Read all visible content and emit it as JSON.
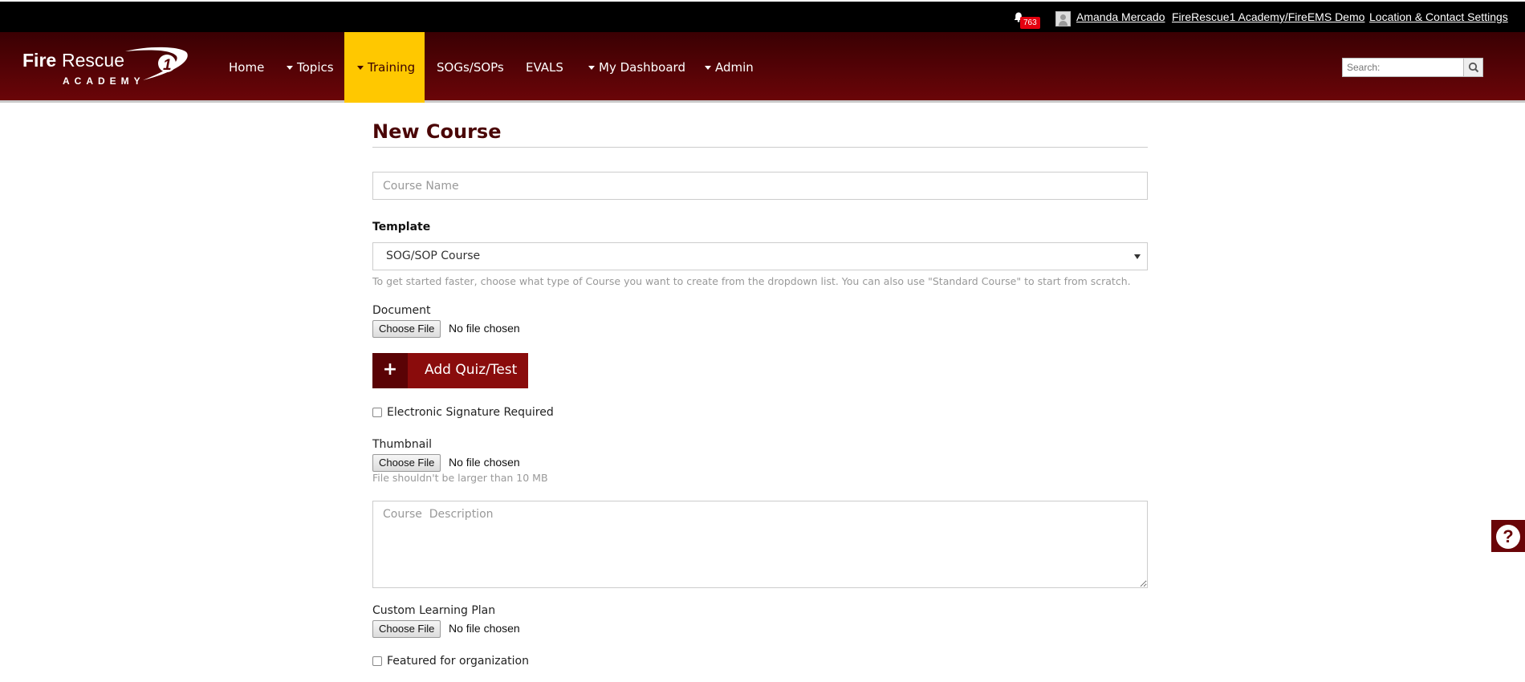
{
  "topbar": {
    "notification_count": "763",
    "user_name": "Amanda Mercado",
    "org_link": "FireRescue1 Academy/FireEMS Demo",
    "location_link": "Location & Contact Settings"
  },
  "logo": {
    "brand_fire": "Fire",
    "brand_rescue": "Rescue",
    "brand_number": "1",
    "brand_sub": "ACADEMY"
  },
  "nav": {
    "items": [
      {
        "label": "Home",
        "dropdown": false
      },
      {
        "label": "Topics",
        "dropdown": true
      },
      {
        "label": "Training",
        "dropdown": true,
        "active": true
      },
      {
        "label": "SOGs/SOPs",
        "dropdown": false
      },
      {
        "label": "EVALS",
        "dropdown": false
      },
      {
        "label": "My Dashboard",
        "dropdown": true
      },
      {
        "label": "Admin",
        "dropdown": true
      }
    ],
    "search_placeholder": "Search:"
  },
  "form": {
    "title": "New Course",
    "course_name_placeholder": "Course Name",
    "template_label": "Template",
    "template_value": "SOG/SOP Course",
    "template_help": "To get started faster, choose what type of Course you want to create from the dropdown list. You can also use \"Standard Course\" to start from scratch.",
    "document_label": "Document",
    "choose_file": "Choose File",
    "no_file": "No file chosen",
    "add_quiz": "Add Quiz/Test",
    "esig_label": "Electronic Signature Required",
    "esig_checked": false,
    "thumbnail_label": "Thumbnail",
    "thumbnail_help": "File shouldn't be larger than 10 MB",
    "description_placeholder": "Course  Description",
    "learning_plan_label": "Custom Learning Plan",
    "featured_label": "Featured for organization",
    "featured_checked": false
  },
  "help_button": "?",
  "colors": {
    "brand_dark": "#3a0003",
    "brand": "#6a0508",
    "active_nav": "#ffc800",
    "button": "#8a0c0c",
    "badge": "#e4000f"
  }
}
